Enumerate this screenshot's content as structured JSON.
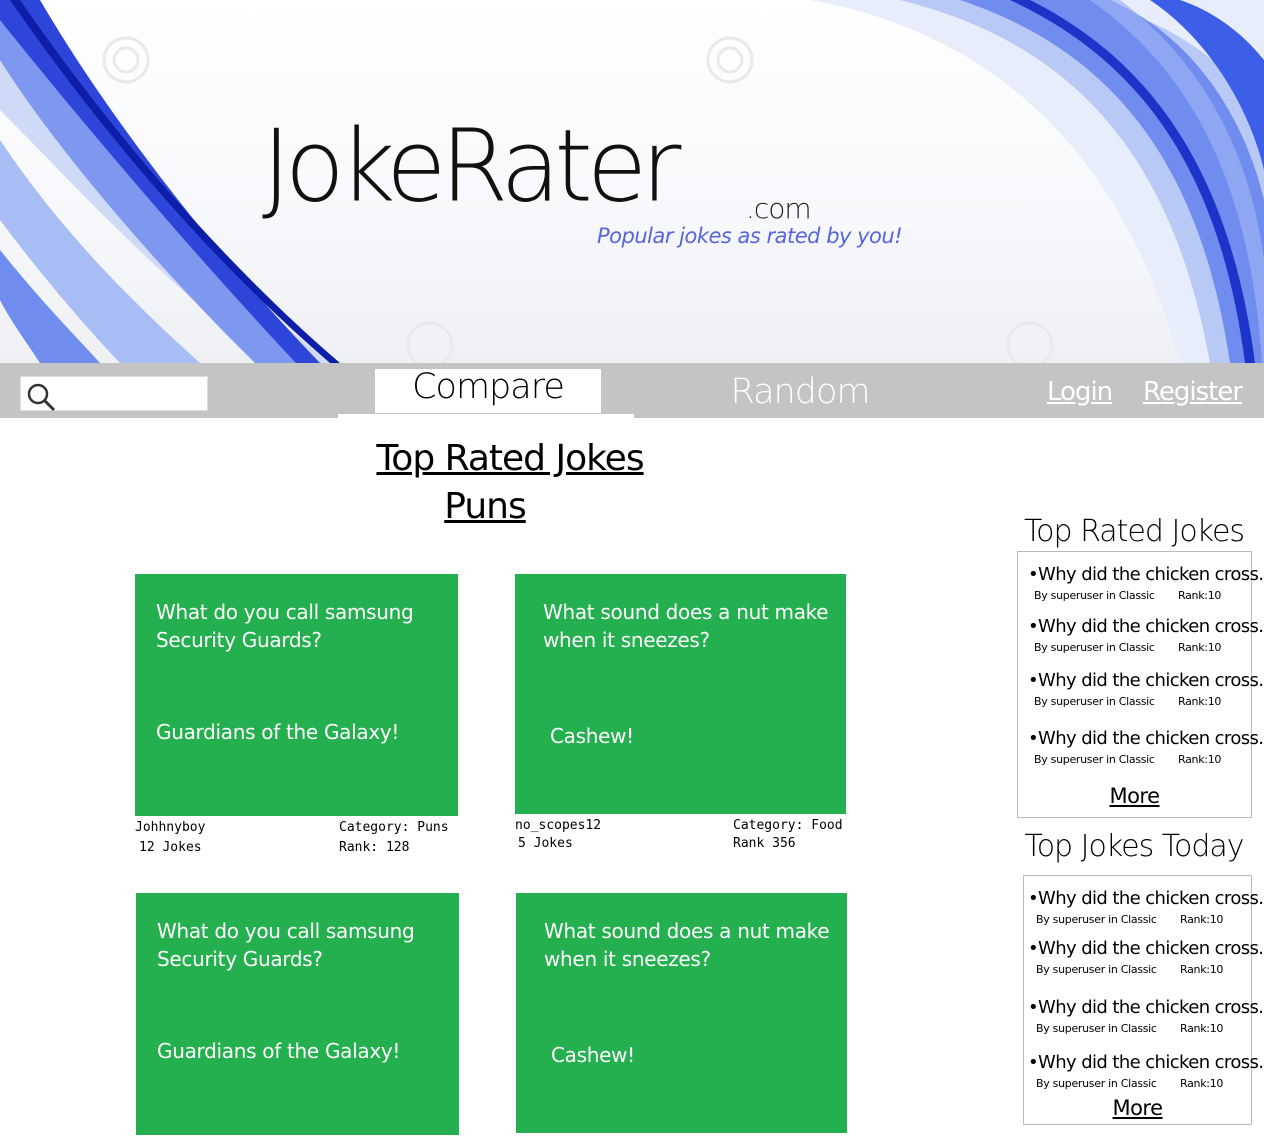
{
  "brand": {
    "logo": "JokeRater",
    "tld": ".com",
    "tagline": "Popular jokes as rated by you!"
  },
  "nav": {
    "search_placeholder": "",
    "compare": "Compare",
    "random": "Random",
    "login": "Login",
    "register": "Register"
  },
  "main": {
    "title": "Top Rated Jokes",
    "subtitle": "Puns",
    "jokes": [
      {
        "question": "What do you call samsung Security Guards?",
        "answer": "Guardians of the Galaxy!",
        "author": "Johhnyboy",
        "count": "12 Jokes",
        "category": "Category: Puns",
        "rank": "Rank: 128"
      },
      {
        "question": "What sound does a nut make when it sneezes?",
        "answer": "Cashew!",
        "author": "no_scopes12",
        "count": "5 Jokes",
        "category": "Category: Food",
        "rank": "Rank 356"
      },
      {
        "question": "What do you call samsung Security Guards?",
        "answer": "Guardians of the Galaxy!"
      },
      {
        "question": "What sound does a nut make when it sneezes?",
        "answer": "Cashew!"
      }
    ]
  },
  "sidebar": {
    "top_rated_title": "Top Rated Jokes",
    "top_today_title": "Top Jokes Today",
    "more": "More",
    "items": [
      {
        "title": "•Why did the chicken cross...",
        "byline": "By superuser in Classic",
        "rank": "Rank:10"
      },
      {
        "title": "•Why did the chicken cross...",
        "byline": "By superuser in Classic",
        "rank": "Rank:10"
      },
      {
        "title": "•Why did the chicken cross...",
        "byline": "By superuser in Classic",
        "rank": "Rank:10"
      },
      {
        "title": "•Why did the chicken cross...",
        "byline": "By superuser in Classic",
        "rank": "Rank:10"
      }
    ]
  },
  "colors": {
    "card_green": "#25b04f",
    "nav_gray": "#c4c4c4",
    "accent_blue": "#3a5fe0"
  }
}
